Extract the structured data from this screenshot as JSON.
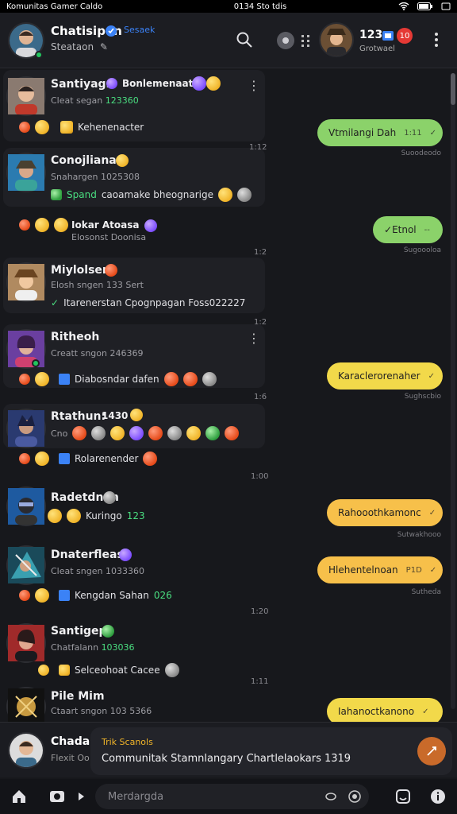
{
  "status_bar": {
    "left": "Komunitas Gamer Caldo",
    "center": "0134 Sto tdis"
  },
  "header": {
    "title": "Chatisipen",
    "tag": "Sesaek",
    "subtitle": "Steataon",
    "user_count": "123",
    "user_sub": "Grotwael",
    "badge": "10"
  },
  "chats": [
    {
      "name": "Santiyagn",
      "tag": "Bonlemenaat",
      "sub": "Cleat segan",
      "sub_num": "123360",
      "preview": "Kehenenacter"
    },
    {
      "name": "Conojlianar",
      "sub": "Snahargen",
      "sub_num": "1025308",
      "preview_tag": "Spand",
      "preview": "caoamake bheognarige"
    },
    {
      "name": "Iokar Atoasa",
      "sub": "Elosonst Doonisa"
    },
    {
      "name": "Miylolsen",
      "sub": "Elosh sngen",
      "sub_num": "133 Sert",
      "preview": "Itarenerstan Cpognpagan Foss022227"
    },
    {
      "name": "Ritheoh",
      "sub": "Creatt sngon",
      "sub_num": "246369",
      "preview": "Diabosndar dafen"
    },
    {
      "name": "Rtathun:",
      "name_tag": "1430",
      "sub": "Cno",
      "preview": "Rolarenender"
    },
    {
      "name": "Radetdnan",
      "sub": "Kuringo",
      "sub_num": "123"
    },
    {
      "name": "Dnaterfleas:",
      "sub": "Cleat sngen",
      "sub_num": "1033360",
      "preview": "Kengdan Sahan",
      "preview_num": "026"
    },
    {
      "name": "Santigep",
      "sub": "Chatfalann",
      "sub_num": "103036",
      "preview": "Selceohoat Cacee"
    },
    {
      "name": "Pile Mim",
      "sub": "Ctaart sngon",
      "sub_num": "103 5366"
    }
  ],
  "timestamps": [
    "1:12",
    "1:2",
    "1:2",
    "1:6",
    "1:00",
    "1:20",
    "1:11"
  ],
  "bubbles": [
    {
      "text": "Vtmilangi Dah",
      "meta": "1:11",
      "foot": "Suoodeodo"
    },
    {
      "text": "Etnol",
      "meta": "--",
      "foot": "Sugoooloa"
    },
    {
      "text": "Karaclerorenaher",
      "meta": "",
      "foot": "Sughscbio"
    },
    {
      "text": "Rahooothkamonc",
      "meta": "",
      "foot": "Sutwakhooo"
    },
    {
      "text": "Hlehentelnoan",
      "meta": "P1D",
      "foot": "Sutheda"
    },
    {
      "text": "Iahanoctkanono",
      "meta": "",
      "foot": ""
    }
  ],
  "now_playing": {
    "name": "Chadar",
    "sub": "Flexit Oo",
    "label": "Trik Scanols",
    "text": "Communitak Stamnlangary Chartlelaokars 1319"
  },
  "composer": {
    "placeholder": "Merdargda"
  },
  "colors": {
    "accent_green": "#8bd26a",
    "accent_yellow": "#f2d94a",
    "accent_orange": "#f7c04a",
    "badge_red": "#e53935"
  }
}
